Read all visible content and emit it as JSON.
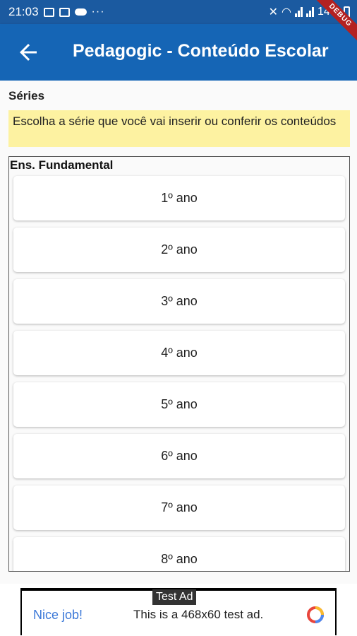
{
  "status_bar": {
    "time": "21:03",
    "battery": "14%"
  },
  "debug_banner": "DEBUG",
  "app_bar": {
    "title": "Pedagogic - Conteúdo Escolar"
  },
  "page": {
    "section_label": "Séries",
    "instructions": "Escolha a série que você vai inserir ou conferir os conteúdos",
    "group_label": "Ens. Fundamental",
    "grades": [
      {
        "label": "1º ano"
      },
      {
        "label": "2º ano"
      },
      {
        "label": "3º ano"
      },
      {
        "label": "4º ano"
      },
      {
        "label": "5º ano"
      },
      {
        "label": "6º ano"
      },
      {
        "label": "7º ano"
      },
      {
        "label": "8º ano"
      }
    ]
  },
  "ad": {
    "tag": "Test Ad",
    "headline": "Nice job!",
    "text": "This is a 468x60 test ad."
  },
  "colors": {
    "status_bar": "#1b5aa0",
    "app_bar": "#1565b5",
    "instructions_bg": "#fdf2a1"
  }
}
